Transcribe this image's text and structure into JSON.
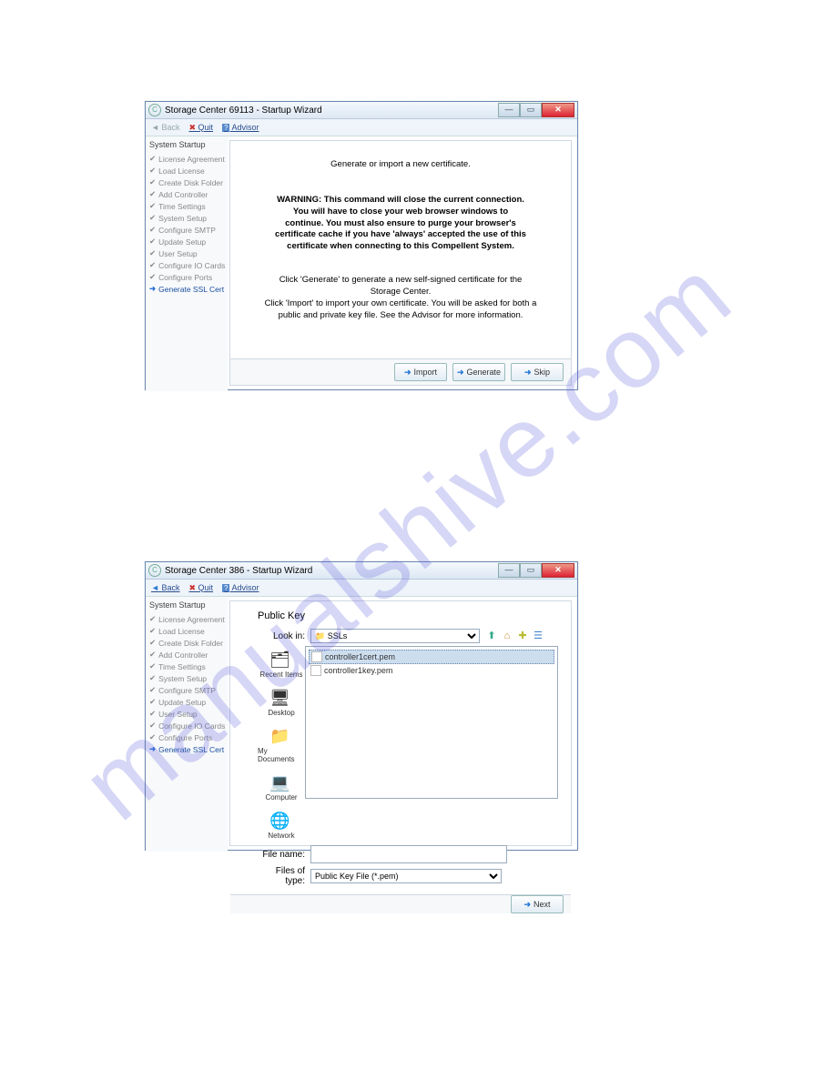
{
  "watermark": "manualshive.com",
  "win1": {
    "title": "Storage Center 69113 - Startup Wizard",
    "toolbar": {
      "back": "Back",
      "quit": "Quit",
      "advisor": "Advisor"
    },
    "steps_header": "System Startup",
    "steps": [
      "License Agreement",
      "Load License",
      "Create Disk Folder",
      "Add Controller",
      "Time Settings",
      "System Setup",
      "Configure SMTP",
      "Update Setup",
      "User Setup",
      "Configure IO Cards",
      "Configure Ports",
      "Generate SSL Cert"
    ],
    "heading": "Generate or import a new certificate.",
    "warning": "WARNING: This command will close the current connection. You will have to close your web browser windows to continue. You must also ensure to purge your browser's certificate cache if you have 'always' accepted the use of this certificate when connecting to this Compellent System.",
    "info": "Click 'Generate' to generate a new self-signed certificate for the Storage Center.\nClick 'Import' to import your own certificate. You will be asked for both a public and private key file. See the Advisor for more information.",
    "buttons": {
      "import": "Import",
      "generate": "Generate",
      "skip": "Skip"
    }
  },
  "win2": {
    "title": "Storage Center 386 - Startup Wizard",
    "toolbar": {
      "back": "Back",
      "quit": "Quit",
      "advisor": "Advisor"
    },
    "steps_header": "System Startup",
    "steps": [
      "License Agreement",
      "Load License",
      "Create Disk Folder",
      "Add Controller",
      "Time Settings",
      "System Setup",
      "Configure SMTP",
      "Update Setup",
      "User Setup",
      "Configure IO Cards",
      "Configure Ports",
      "Generate SSL Cert"
    ],
    "panel_title": "Public Key",
    "lookin_label": "Look in:",
    "lookin_value": "SSLs",
    "places": [
      "Recent Items",
      "Desktop",
      "My Documents",
      "Computer",
      "Network"
    ],
    "files": [
      {
        "name": "controller1cert.pem",
        "sel": true
      },
      {
        "name": "controller1key.pem",
        "sel": false
      }
    ],
    "filename_label": "File name:",
    "filename_value": "",
    "filetype_label": "Files of type:",
    "filetype_value": "Public Key File (*.pem)",
    "buttons": {
      "next": "Next"
    }
  }
}
